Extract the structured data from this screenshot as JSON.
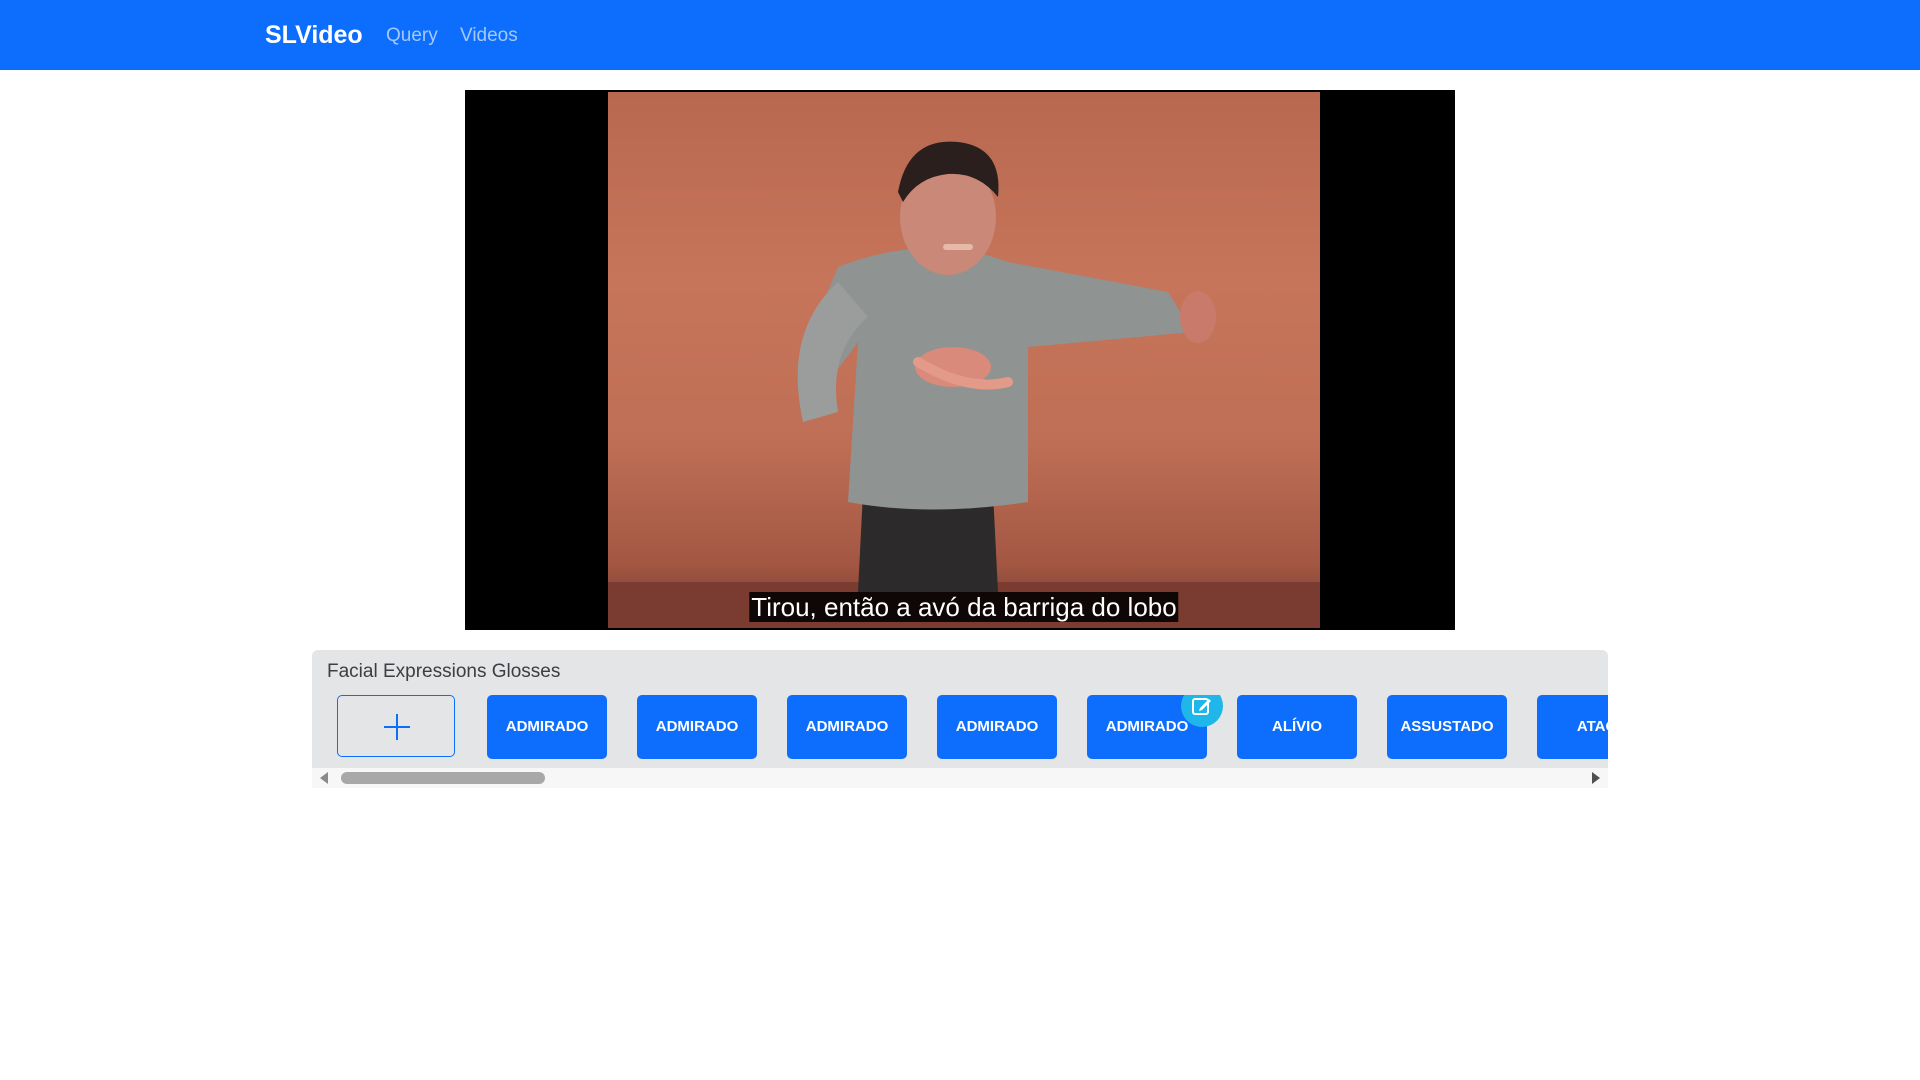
{
  "navbar": {
    "brand": "SLVideo",
    "links": [
      {
        "label": "Query"
      },
      {
        "label": "Videos"
      }
    ],
    "bg_color": "#0d6efd"
  },
  "video": {
    "subtitle": "Tirou, então a avó da barriga do lobo"
  },
  "glosses": {
    "title": "Facial Expressions Glosses",
    "add_icon": "plus-icon",
    "edit_icon": "edit-icon",
    "edit_badge_color": "#1fb7ea",
    "chips": [
      {
        "label": "ADMIRADO"
      },
      {
        "label": "ADMIRADO"
      },
      {
        "label": "ADMIRADO"
      },
      {
        "label": "ADMIRADO"
      },
      {
        "label": "ADMIRADO"
      },
      {
        "label": "ALÍVIO"
      },
      {
        "label": "ASSUSTADO"
      },
      {
        "label": "ATAQ"
      }
    ],
    "chip_color": "#0d6efd"
  }
}
